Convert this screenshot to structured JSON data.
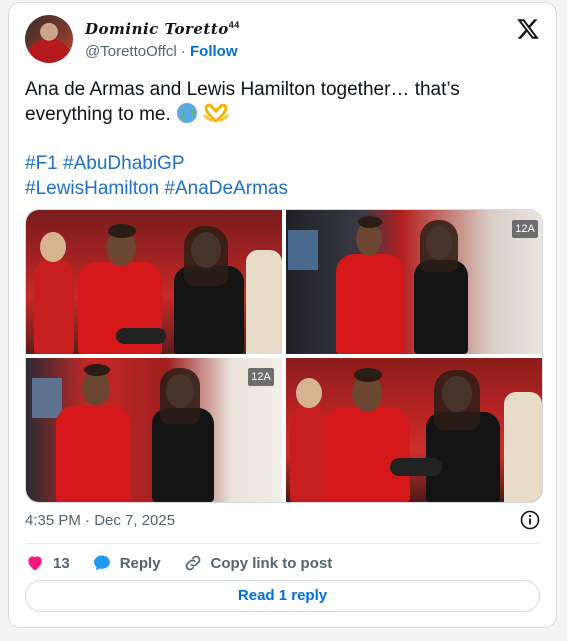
{
  "author": {
    "display_name": "Dominic Toretto",
    "superscript": "44",
    "handle": "@TorettoOffcl",
    "separator": "·",
    "follow_label": "Follow"
  },
  "tweet": {
    "line1": "Ana de Armas and Lewis Hamilton together… that’s",
    "line2": "everything to me.",
    "emojis": [
      "globe-emoji",
      "heart-hands-emoji"
    ],
    "hashtags_line1": [
      "#F1",
      "#AbuDhabiGP"
    ],
    "hashtags_line2": [
      "#LewisHamilton",
      "#AnaDeArmas"
    ]
  },
  "media": {
    "photo_count": 4,
    "badges": [
      "12A",
      "12A"
    ]
  },
  "timestamp": "4:35 PM · Dec 7, 2025",
  "actions": {
    "like_count": "13",
    "reply_label": "Reply",
    "copy_link_label": "Copy link to post"
  },
  "read_replies_label": "Read 1 reply",
  "colors": {
    "accent": "#006fd6",
    "hashtag": "#1d70c9",
    "like": "#f91880",
    "reply": "#1d9bf0",
    "text": "#0f1419",
    "muted": "#536471"
  },
  "icons": [
    "x-logo-icon",
    "info-icon",
    "heart-icon",
    "reply-bubble-icon",
    "link-icon"
  ]
}
